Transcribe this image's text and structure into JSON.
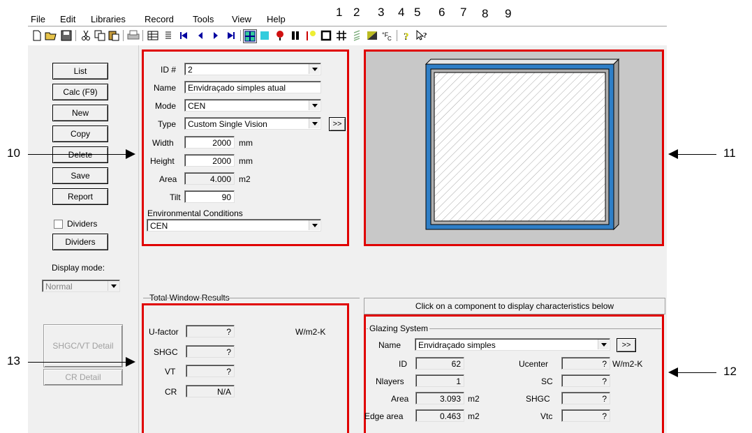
{
  "menu": [
    "File",
    "Edit",
    "Libraries",
    "Record",
    "Tools",
    "View",
    "Help"
  ],
  "callouts": {
    "top": [
      "1",
      "2",
      "3",
      "4",
      "5",
      "6",
      "7",
      "8",
      "9"
    ],
    "n10": "10",
    "n11": "11",
    "n12": "12",
    "n13": "13"
  },
  "toolbar": {
    "icons": [
      "new-file-icon",
      "open-folder-icon",
      "save-disk-icon",
      "cut-icon",
      "copy-icon",
      "paste-icon",
      "print-icon",
      "grid-view-icon",
      "list-view-icon",
      "first-record-icon",
      "previous-record-icon",
      "next-record-icon",
      "last-record-icon",
      "frame-icon",
      "glazing-icon",
      "divider-icon",
      "spacer-icon",
      "shading-icon",
      "window-icon",
      "grid-icon",
      "hatch-icon",
      "gas-icon",
      "temperature-icon",
      "help-icon",
      "context-help-icon"
    ],
    "colors": {
      "accent": "#1e6fd9",
      "red": "#e00000",
      "frame": "#2f7fc7"
    }
  },
  "leftpanel": {
    "list": "List",
    "calc": "Calc (F9)",
    "new": "New",
    "copy": "Copy",
    "delete": "Delete",
    "save": "Save",
    "report": "Report",
    "dividers_check": "Dividers",
    "dividers_btn": "Dividers",
    "display_mode_label": "Display mode:",
    "display_mode_value": "Normal",
    "shgc_detail": "SHGC/VT Detail",
    "cr_detail": "CR Detail"
  },
  "form": {
    "id_label": "ID #",
    "id_value": "2",
    "name_label": "Name",
    "name_value": "Envidraçado simples atual",
    "mode_label": "Mode",
    "mode_value": "CEN",
    "type_label": "Type",
    "type_value": "Custom Single Vision",
    "type_more": ">>",
    "width_label": "Width",
    "width_value": "2000",
    "width_unit": "mm",
    "height_label": "Height",
    "height_value": "2000",
    "height_unit": "mm",
    "area_label": "Area",
    "area_value": "4.000",
    "area_unit": "m2",
    "tilt_label": "Tilt",
    "tilt_value": "90",
    "env_label": "Environmental Conditions",
    "env_value": "CEN"
  },
  "results": {
    "title": "Total Window Results",
    "ufactor_label": "U-factor",
    "ufactor_value": "?",
    "ufactor_unit": "W/m2-K",
    "shgc_label": "SHGC",
    "shgc_value": "?",
    "vt_label": "VT",
    "vt_value": "?",
    "cr_label": "CR",
    "cr_value": "N/A"
  },
  "component": {
    "hint": "Click on a component to display characteristics below",
    "group_title": "Glazing System",
    "name_label": "Name",
    "name_value": "Envidraçado simples",
    "more": ">>",
    "id_label": "ID",
    "id_value": "62",
    "nlayers_label": "Nlayers",
    "nlayers_value": "1",
    "area_label": "Area",
    "area_value": "3.093",
    "area_unit": "m2",
    "edge_label": "Edge area",
    "edge_value": "0.463",
    "edge_unit": "m2",
    "ucenter_label": "Ucenter",
    "ucenter_value": "?",
    "ucenter_unit": "W/m2-K",
    "sc_label": "SC",
    "sc_value": "?",
    "shgc_label": "SHGC",
    "shgc_value": "?",
    "vtc_label": "Vtc",
    "vtc_value": "?"
  }
}
